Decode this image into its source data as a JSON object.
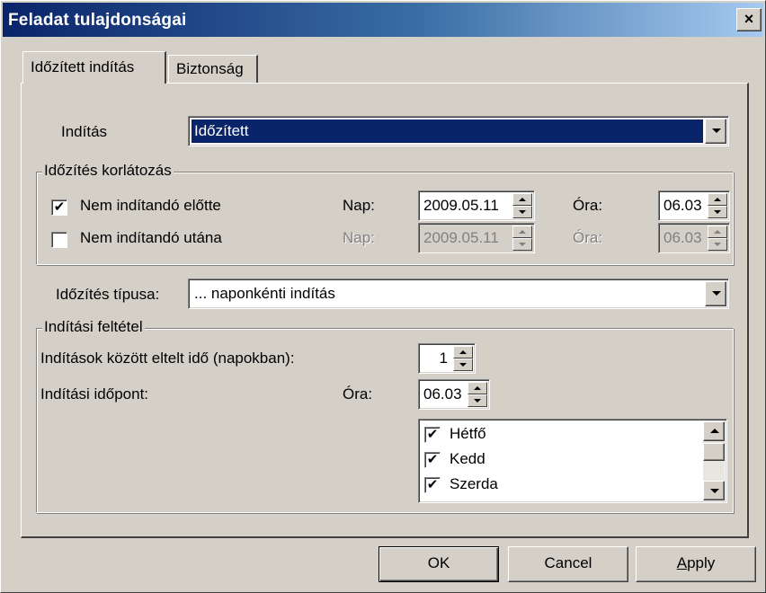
{
  "window": {
    "title": "Feladat tulajdonságai",
    "close_symbol": "×"
  },
  "tabs": [
    {
      "label": "Időzített indítás",
      "active": true
    },
    {
      "label": "Biztonság",
      "active": false
    }
  ],
  "start": {
    "label": "Indítás",
    "selected": "Időzített"
  },
  "limit_group": {
    "legend": "Időzítés korlátozás",
    "not_before": {
      "label": "Nem indítandó előtte",
      "checked": true,
      "day_label": "Nap:",
      "day_value": "2009.05.11",
      "hour_label": "Óra:",
      "hour_value": "06.03"
    },
    "not_after": {
      "label": "Nem indítandó utána",
      "checked": false,
      "day_label": "Nap:",
      "day_value": "2009.05.11",
      "hour_label": "Óra:",
      "hour_value": "06.03"
    }
  },
  "schedule_type": {
    "label": "Időzítés típusa:",
    "selected": "... naponkénti indítás"
  },
  "condition_group": {
    "legend": "Indítási feltétel",
    "interval_label": "Indítások között eltelt idő (napokban):",
    "interval_value": "1",
    "time_label": "Indítási időpont:",
    "hour_label": "Óra:",
    "hour_value": "06.03",
    "days": [
      {
        "label": "Hétfő",
        "checked": true
      },
      {
        "label": "Kedd",
        "checked": true
      },
      {
        "label": "Szerda",
        "checked": true
      }
    ]
  },
  "buttons": {
    "ok": "OK",
    "cancel": "Cancel",
    "apply": "Apply"
  },
  "colors": {
    "face": "#d4d0c8",
    "title_start": "#0a246a",
    "title_end": "#a6caf0",
    "selection": "#0a246a"
  },
  "icons": {
    "check": "✔",
    "close": "close-icon",
    "dropdown": "chevron-down-icon"
  }
}
